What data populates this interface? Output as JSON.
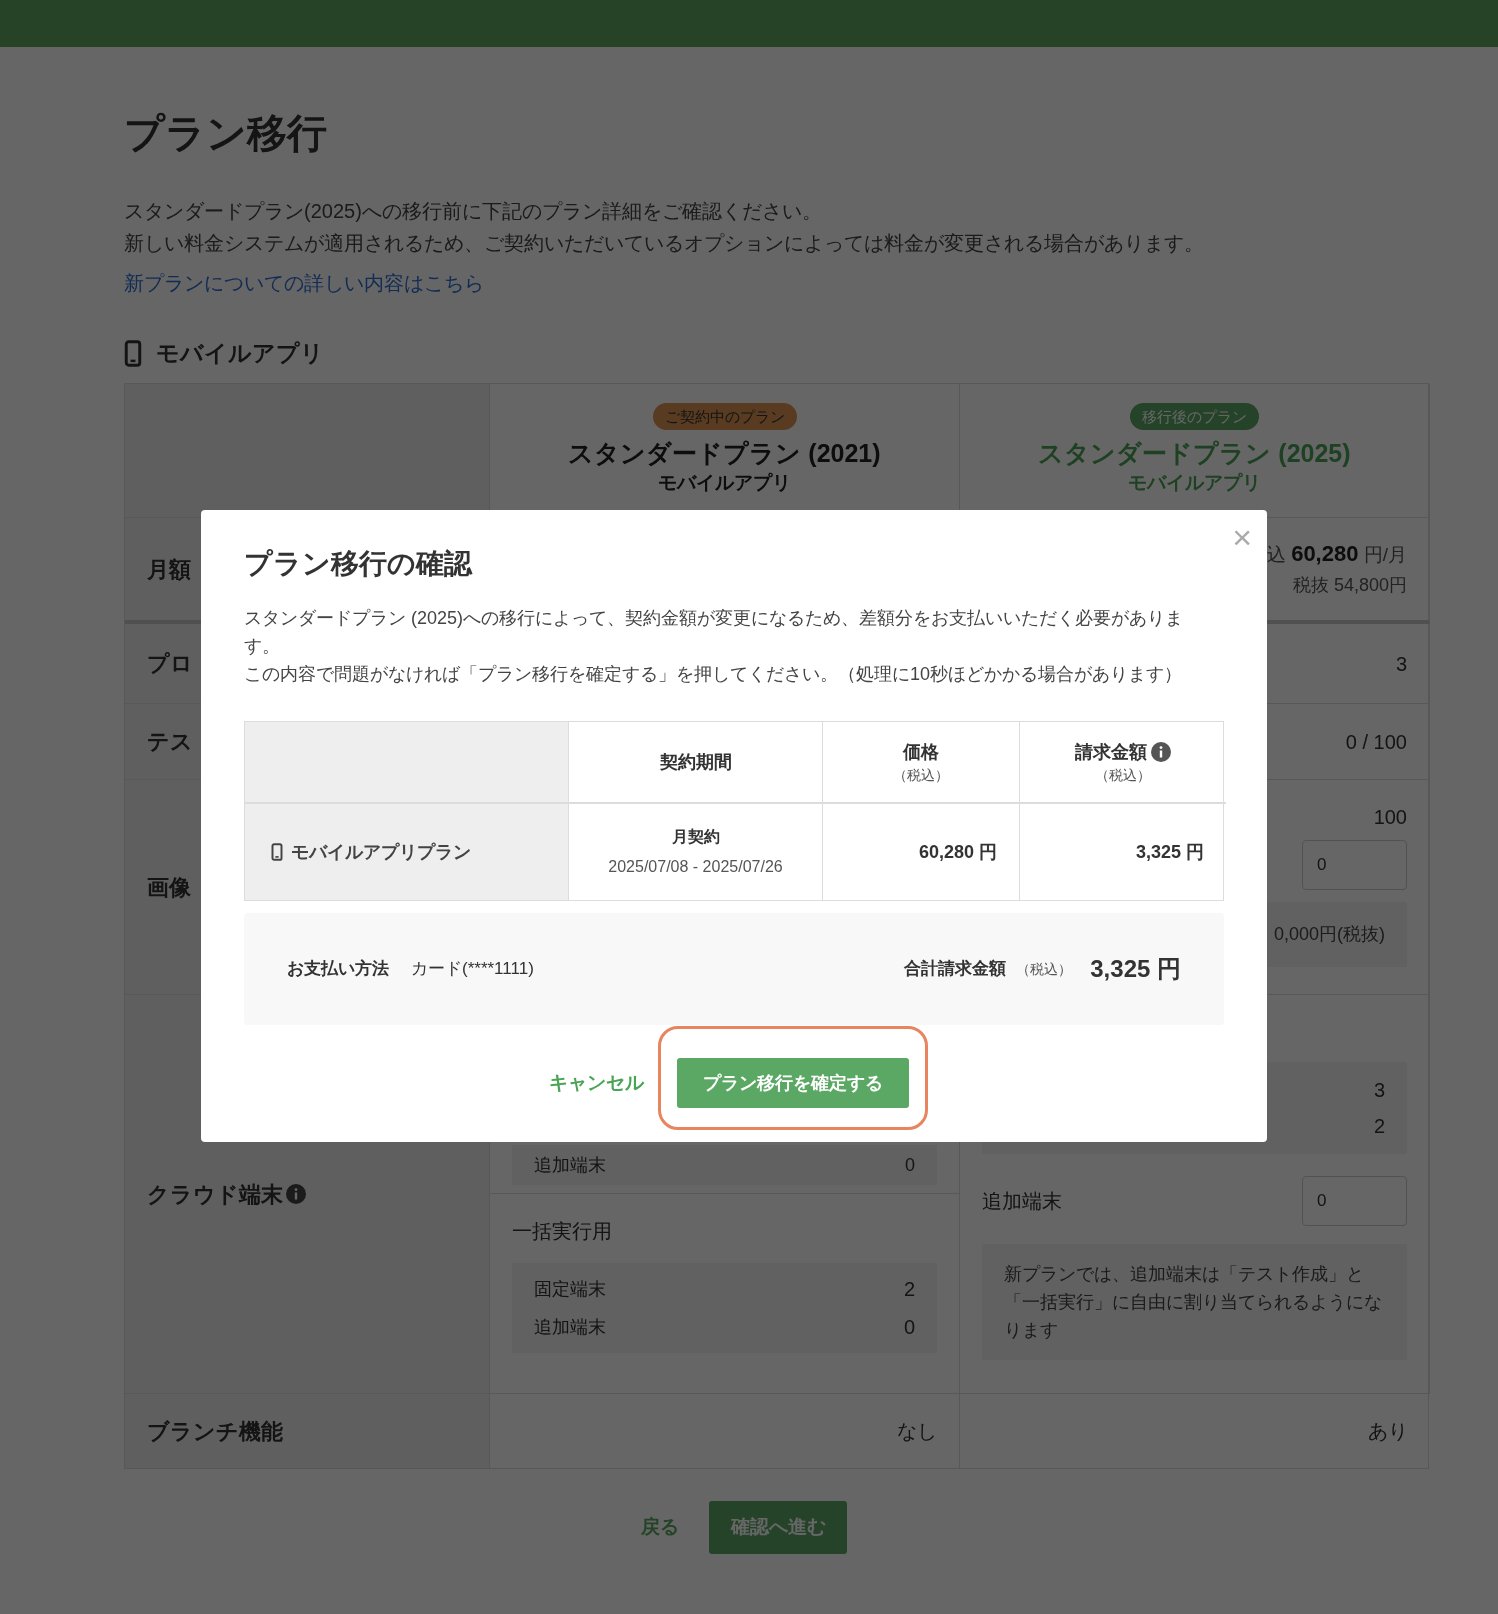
{
  "page": {
    "title": "プラン移行",
    "description": [
      "スタンダードプラン(2025)への移行前に下記のプラン詳細をご確認ください。",
      "新しい料金システムが適用されるため、ご契約いただいているオプションによっては料金が変更される場合があります。"
    ],
    "link": "新プランについての詳しい内容はこちら"
  },
  "section": {
    "title": "モバイルアプリ"
  },
  "plans": [
    {
      "kind": "current",
      "badge": "ご契約中のプラン",
      "name": "スタンダードプラン (2021)",
      "subtitle": "モバイルアプリ"
    },
    {
      "kind": "new",
      "badge": "移行後のプラン",
      "name": "スタンダードプラン (2025)",
      "subtitle": "モバイルアプリ"
    }
  ],
  "rows": {
    "monthly": {
      "label": "月額",
      "new_price": "込 **60,280** 円/月",
      "new_price_excl": "税抜 54,800円"
    },
    "projects": {
      "label": "プロ",
      "new_value": "3"
    },
    "tests": {
      "label": "テス",
      "new_value": "0 / 100"
    },
    "images": {
      "label": "画像",
      "new_value": "100",
      "new_input": "0",
      "new_note": "0,000円(税抜)"
    },
    "cloud": {
      "label": "クラウド端末",
      "current_top": {
        "label": "追加端末",
        "value": "0"
      },
      "current_group": {
        "title": "一括実行用",
        "items": [
          {
            "label": "固定端末",
            "value": "2"
          },
          {
            "label": "追加端末",
            "value": "0"
          }
        ]
      },
      "new_values": [
        "3",
        "2"
      ],
      "new_extra_label": "追加端末",
      "new_extra_input": "0",
      "new_note": "新プランでは、追加端末は「テスト作成」と「一括実行」に自由に割り当てられるようになります"
    },
    "branch": {
      "label": "ブランチ機能",
      "current": "なし",
      "new": "あり"
    }
  },
  "footer": {
    "back": "戻る",
    "next": "確認へ進む"
  },
  "modal": {
    "title": "プラン移行の確認",
    "close": "×",
    "message": [
      "スタンダードプラン (2025)への移行によって、契約金額が変更になるため、差額分をお支払いいただく必要があります。",
      "この内容で問題がなければ「プラン移行を確定する」を押してください。（処理に10秒ほどかかる場合があります）"
    ],
    "table": {
      "columns": [
        {
          "label": "契約期間"
        },
        {
          "label": "価格",
          "note": "（税込）"
        },
        {
          "label": "請求金額",
          "note": "（税込）",
          "info": true
        }
      ],
      "row": {
        "name": "モバイルアプリプラン",
        "term": "月契約",
        "period": "2025/07/08 - 2025/07/26",
        "price": "60,280 円",
        "billing": "3,325 円"
      }
    },
    "summary": {
      "payment_label": "お支払い方法",
      "payment_value": "カード(****1111)",
      "total_label": "合計請求金額",
      "total_note": "（税込）",
      "total_value": "3,325 円"
    },
    "cancel": "キャンセル",
    "confirm": "プラン移行を確定する",
    "confirm_highlighted": true
  }
}
